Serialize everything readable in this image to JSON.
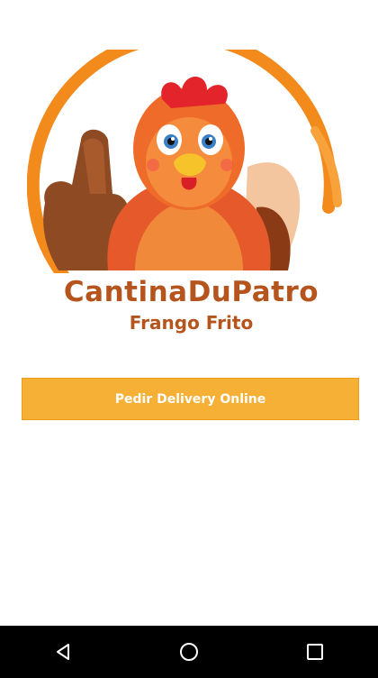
{
  "logo": {
    "brand_name": "CantinaDuPatro",
    "tagline": "Frango Frito",
    "ring_color": "#f28a1c",
    "text_color": "#b5541c"
  },
  "actions": {
    "delivery_label": "Pedir Delivery Online",
    "button_color": "#f6b036"
  },
  "navigation": {
    "back": "back-icon",
    "home": "home-icon",
    "recents": "recents-icon"
  }
}
